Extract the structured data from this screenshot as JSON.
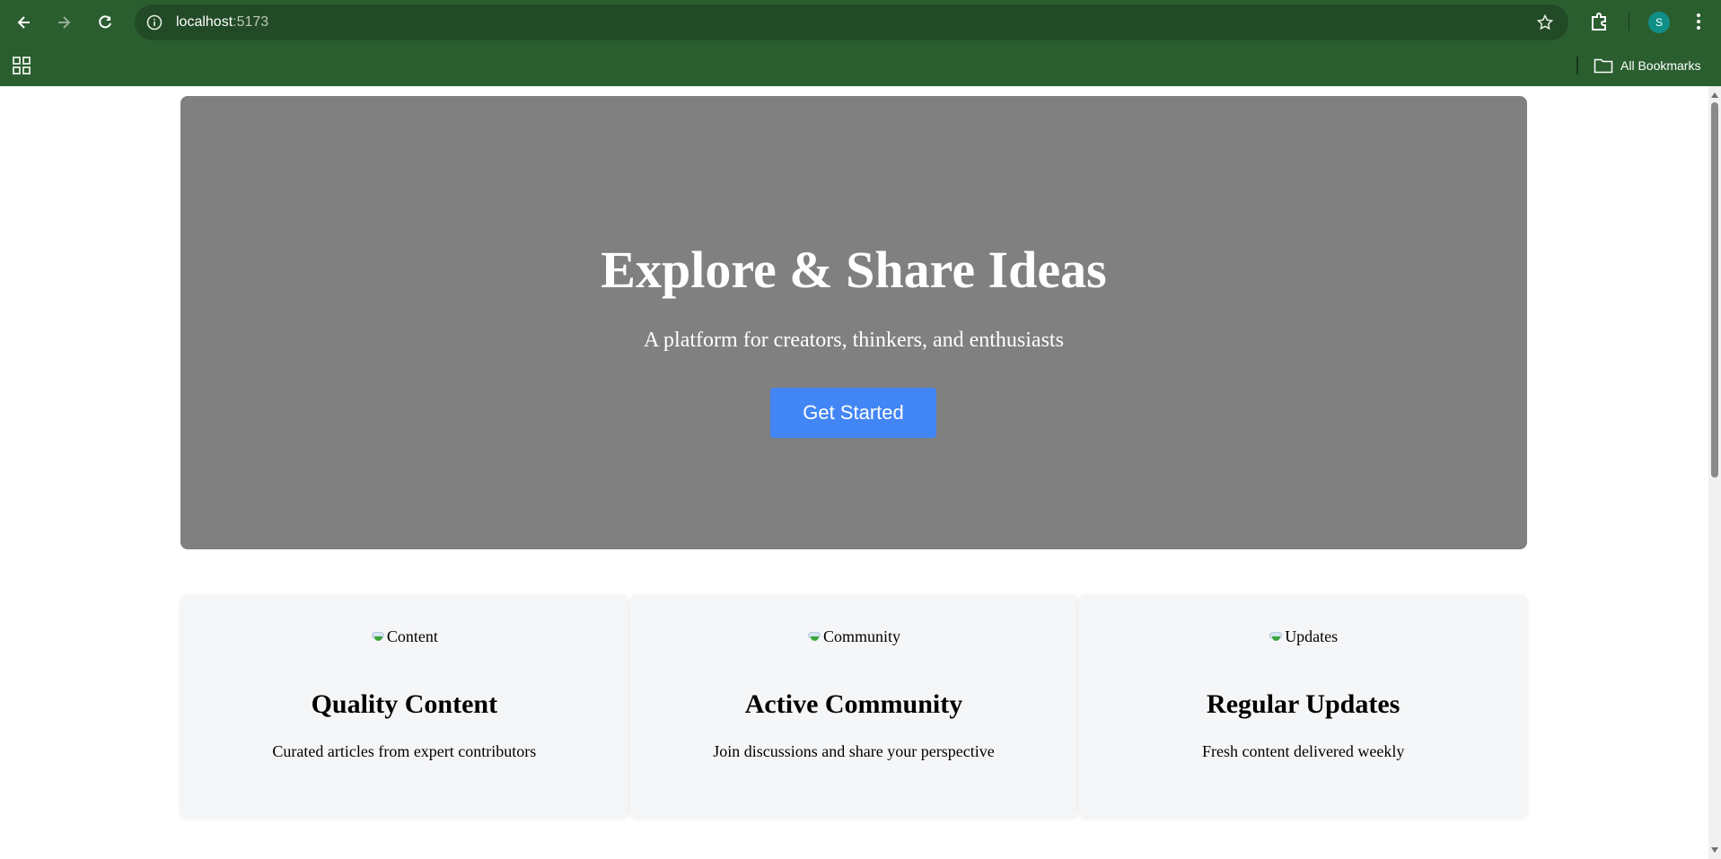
{
  "browser": {
    "url_host": "localhost",
    "url_port": ":5173",
    "profile_initial": "S",
    "bookmarks_label": "All Bookmarks",
    "icons": [
      "back-arrow-icon",
      "forward-arrow-icon",
      "reload-icon",
      "site-info-icon",
      "bookmark-star-icon",
      "extensions-icon",
      "profile-avatar",
      "menu-kebab-icon",
      "apps-grid-icon",
      "folder-icon"
    ],
    "theme_color": "#2b5e2f"
  },
  "hero": {
    "title": "Explore & Share Ideas",
    "subtitle": "A platform for creators, thinkers, and enthusiasts",
    "cta_label": "Get Started",
    "background": "#808080",
    "cta_color": "#4285f4"
  },
  "features": [
    {
      "img_alt": "Content",
      "title": "Quality Content",
      "text": "Curated articles from expert contributors"
    },
    {
      "img_alt": "Community",
      "title": "Active Community",
      "text": "Join discussions and share your perspective"
    },
    {
      "img_alt": "Updates",
      "title": "Regular Updates",
      "text": "Fresh content delivered weekly"
    }
  ]
}
